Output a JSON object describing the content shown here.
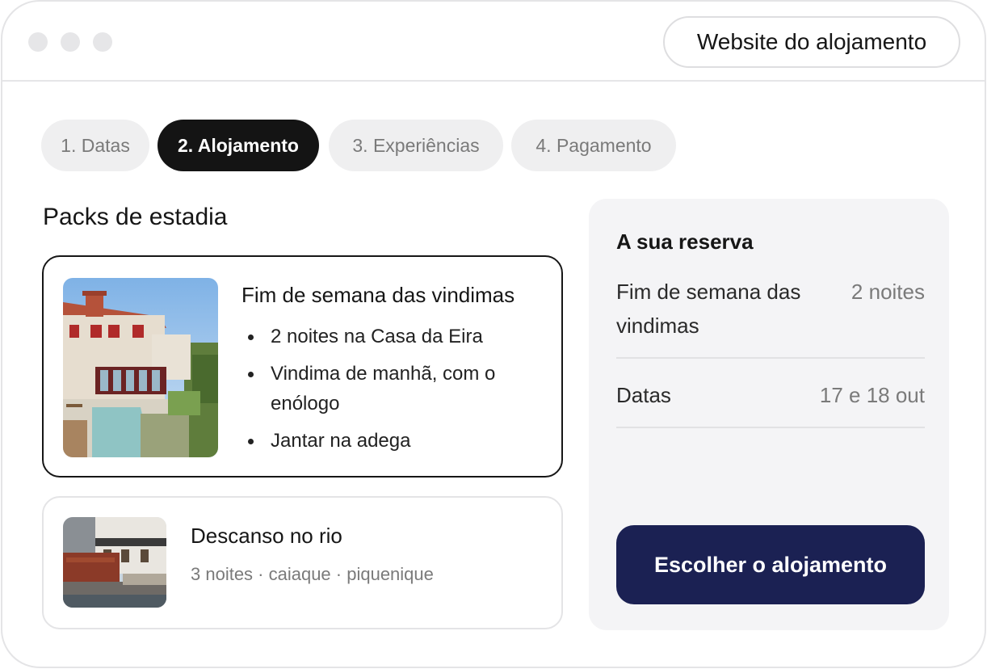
{
  "header": {
    "website_button": "Website do alojamento"
  },
  "steps": [
    {
      "label": "1. Datas",
      "active": false
    },
    {
      "label": "2. Alojamento",
      "active": true
    },
    {
      "label": "3. Experiências",
      "active": false
    },
    {
      "label": "4. Pagamento",
      "active": false
    }
  ],
  "packs": {
    "title": "Packs de estadia",
    "items": [
      {
        "name": "Fim de semana das vindimas",
        "selected": true,
        "features": [
          "2 noites na Casa da Eira",
          "Vindima de manhã, com o enólogo",
          "Jantar na adega"
        ]
      },
      {
        "name": "Descanso no rio",
        "selected": false,
        "meta": "3 noites · caiaque · piquenique"
      }
    ]
  },
  "summary": {
    "heading": "A sua reserva",
    "rows": [
      {
        "label": "Fim de semana das vindimas",
        "value": "2 noites"
      },
      {
        "label": "Datas",
        "value": "17 e 18 out"
      }
    ],
    "cta": "Escolher o alojamento"
  },
  "colors": {
    "accent": "#1b2153",
    "active_tab": "#141414",
    "panel_bg": "#f4f4f6"
  }
}
